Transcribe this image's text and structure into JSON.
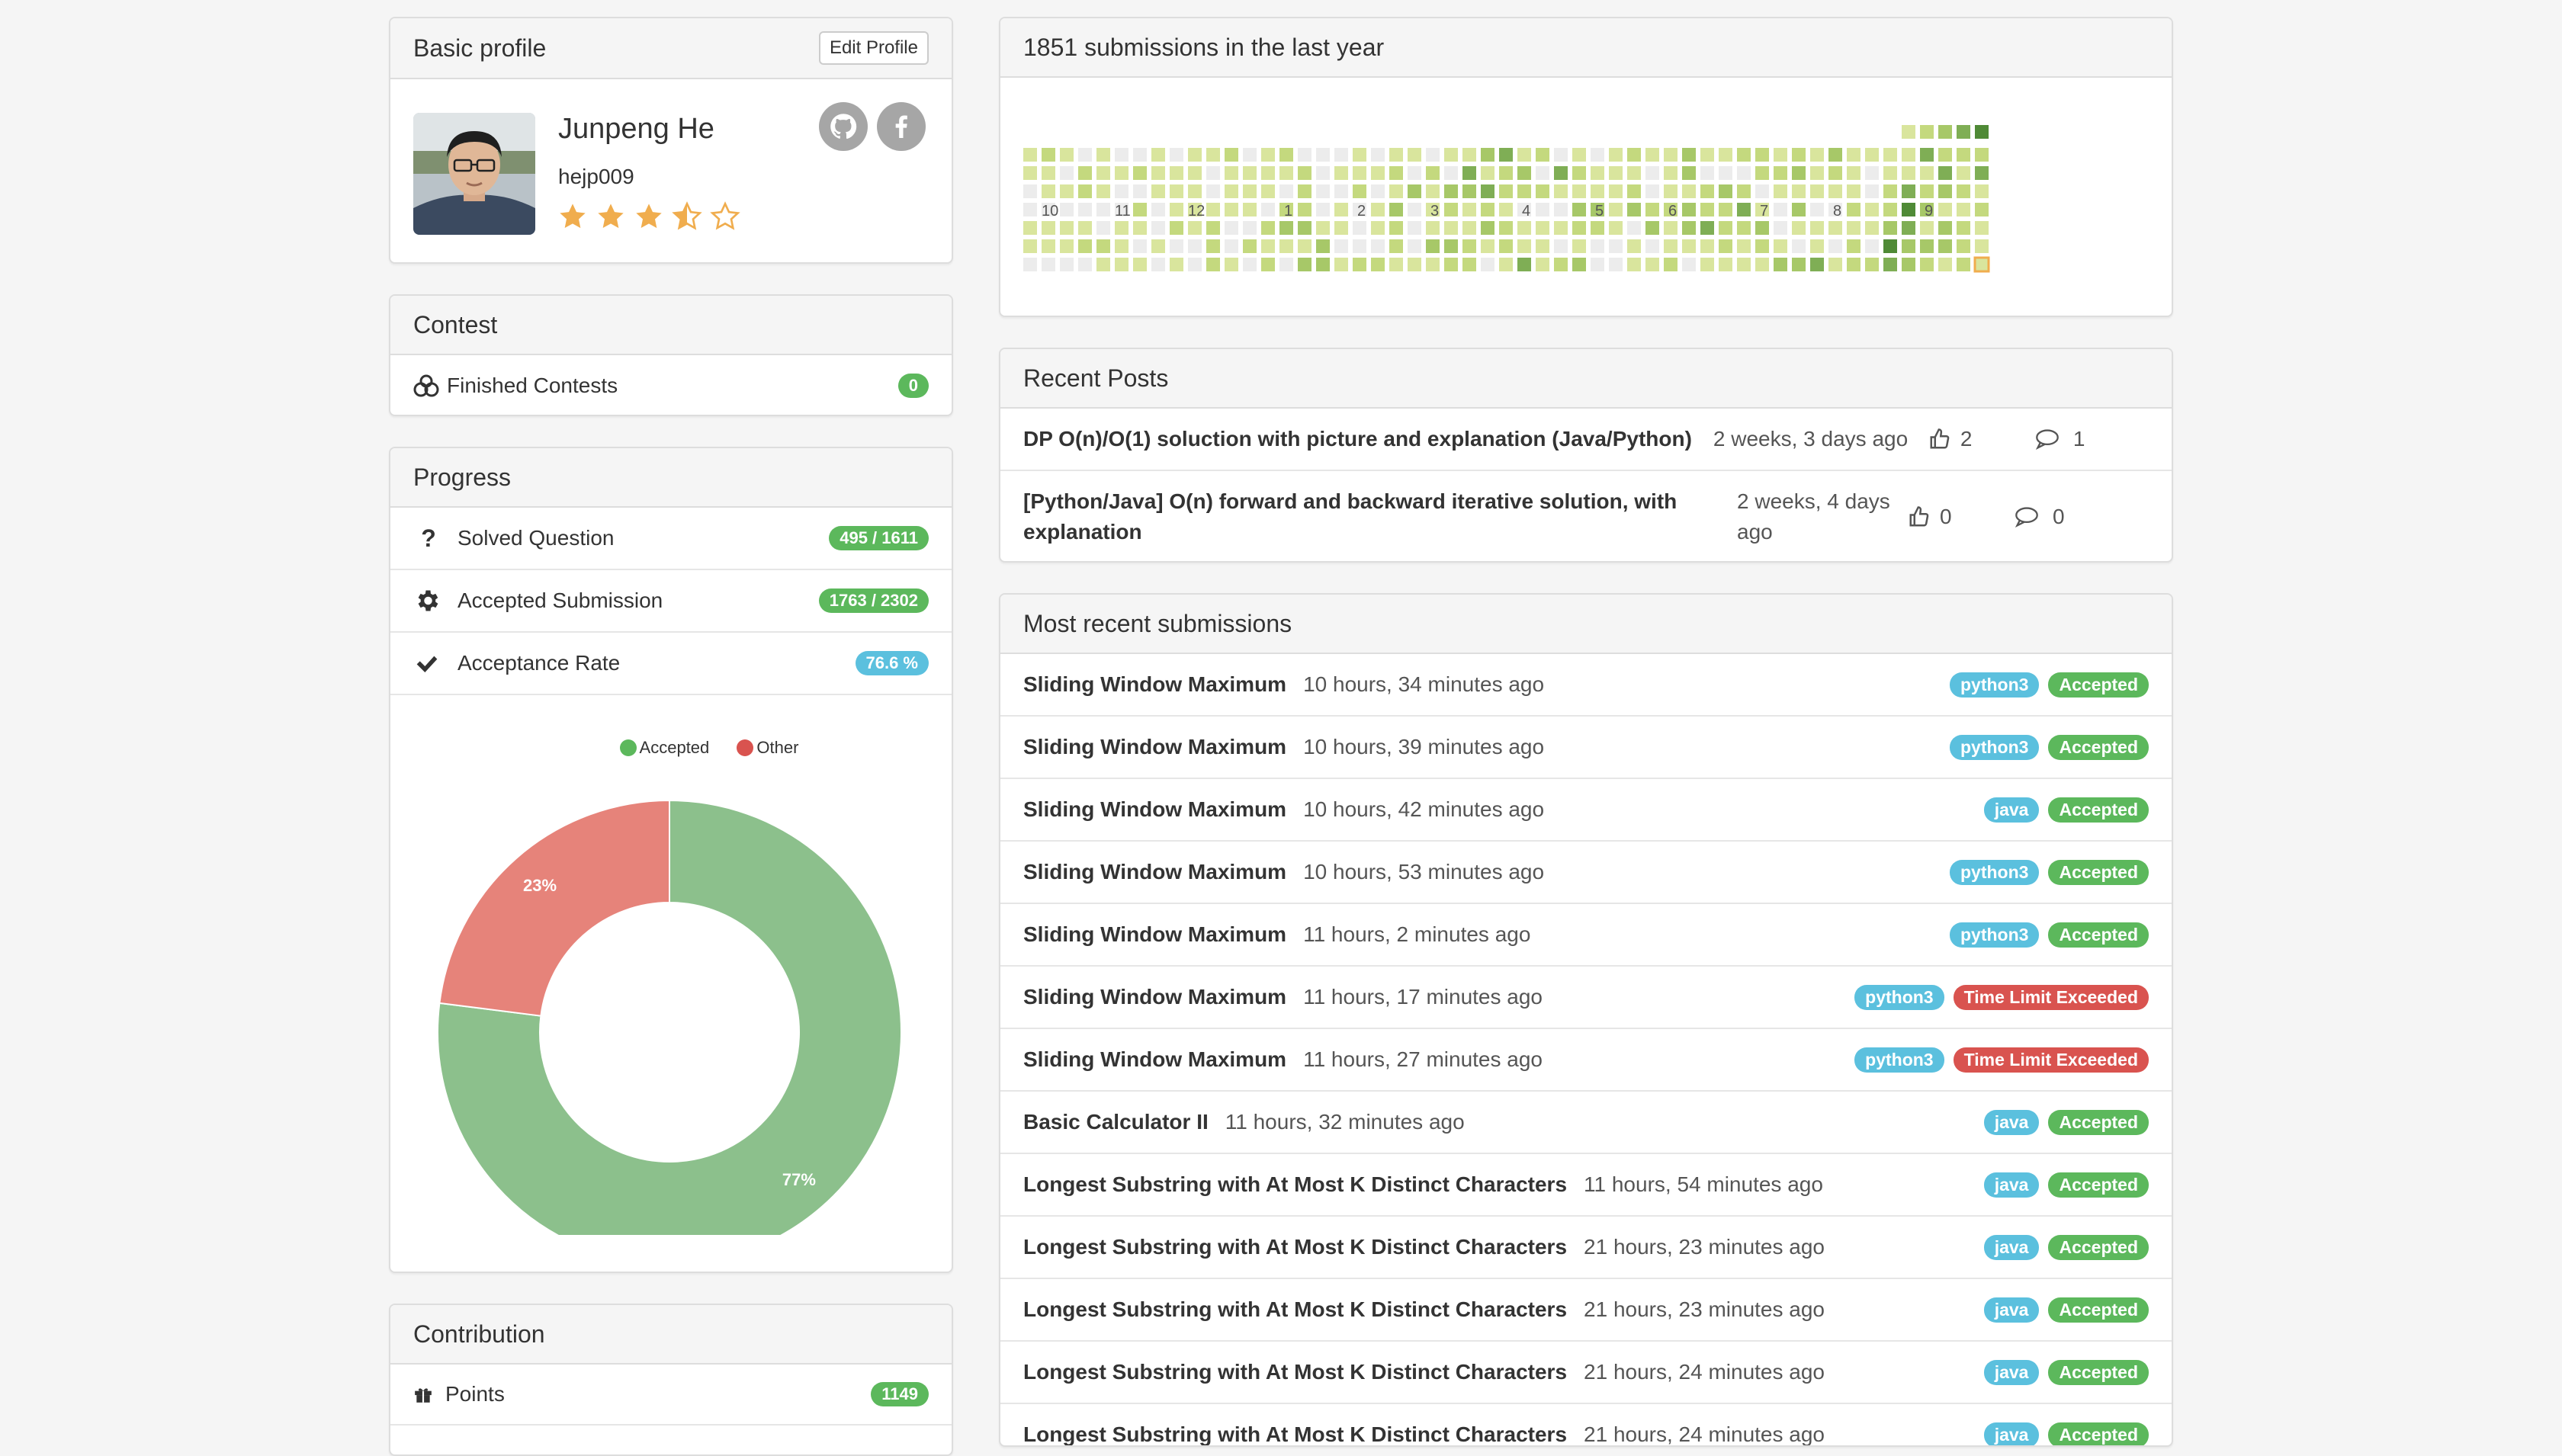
{
  "profile": {
    "header": "Basic profile",
    "edit_label": "Edit Profile",
    "name": "Junpeng He",
    "username": "hejp009",
    "rating": 3.5,
    "max_rating": 5
  },
  "contest": {
    "header": "Contest",
    "items": [
      {
        "label": "Finished Contests",
        "value": "0",
        "icon": "trophy-icon"
      }
    ]
  },
  "progress": {
    "header": "Progress",
    "items": [
      {
        "label": "Solved Question",
        "value": "495 / 1611",
        "icon": "question-icon"
      },
      {
        "label": "Accepted Submission",
        "value": "1763 / 2302",
        "icon": "gear-icon"
      },
      {
        "label": "Acceptance Rate",
        "value": "76.6 %",
        "icon": "check-icon"
      }
    ]
  },
  "chart_data": {
    "type": "pie",
    "donut": true,
    "labels": [
      "Accepted",
      "Other"
    ],
    "values": [
      77,
      23
    ],
    "value_labels": [
      "77%",
      "23%"
    ],
    "colors": [
      "#8cc08c",
      "#e6837a"
    ],
    "legend_colors": [
      "#5cb85c",
      "#d9534f"
    ],
    "legend_position": "top"
  },
  "contribution": {
    "header": "Contribution",
    "items": [
      {
        "label": "Points",
        "value": "1149",
        "icon": "gift-icon"
      }
    ]
  },
  "calendar": {
    "header": "1851 submissions in the last year",
    "months": [
      "10",
      "11",
      "12",
      "1",
      "2",
      "3",
      "4",
      "5",
      "6",
      "7",
      "8",
      "9"
    ]
  },
  "posts": {
    "header": "Recent Posts",
    "items": [
      {
        "title": "DP O(n)/O(1) soluction with picture and explanation (Java/Python)",
        "time": "2 weeks, 3 days ago",
        "votes": "2",
        "comments": "1"
      },
      {
        "title": "[Python/Java] O(n) forward and backward iterative solution, with explanation",
        "time": "2 weeks, 4 days ago",
        "votes": "0",
        "comments": "0"
      }
    ]
  },
  "submissions": {
    "header": "Most recent submissions",
    "items": [
      {
        "title": "Sliding Window Maximum",
        "time": "10 hours, 34 minutes ago",
        "lang": "python3",
        "status": "Accepted"
      },
      {
        "title": "Sliding Window Maximum",
        "time": "10 hours, 39 minutes ago",
        "lang": "python3",
        "status": "Accepted"
      },
      {
        "title": "Sliding Window Maximum",
        "time": "10 hours, 42 minutes ago",
        "lang": "java",
        "status": "Accepted"
      },
      {
        "title": "Sliding Window Maximum",
        "time": "10 hours, 53 minutes ago",
        "lang": "python3",
        "status": "Accepted"
      },
      {
        "title": "Sliding Window Maximum",
        "time": "11 hours, 2 minutes ago",
        "lang": "python3",
        "status": "Accepted"
      },
      {
        "title": "Sliding Window Maximum",
        "time": "11 hours, 17 minutes ago",
        "lang": "python3",
        "status": "Time Limit Exceeded"
      },
      {
        "title": "Sliding Window Maximum",
        "time": "11 hours, 27 minutes ago",
        "lang": "python3",
        "status": "Time Limit Exceeded"
      },
      {
        "title": "Basic Calculator II",
        "time": "11 hours, 32 minutes ago",
        "lang": "java",
        "status": "Accepted"
      },
      {
        "title": "Longest Substring with At Most K Distinct Characters",
        "time": "11 hours, 54 minutes ago",
        "lang": "java",
        "status": "Accepted"
      },
      {
        "title": "Longest Substring with At Most K Distinct Characters",
        "time": "21 hours, 23 minutes ago",
        "lang": "java",
        "status": "Accepted"
      },
      {
        "title": "Longest Substring with At Most K Distinct Characters",
        "time": "21 hours, 23 minutes ago",
        "lang": "java",
        "status": "Accepted"
      },
      {
        "title": "Longest Substring with At Most K Distinct Characters",
        "time": "21 hours, 24 minutes ago",
        "lang": "java",
        "status": "Accepted"
      },
      {
        "title": "Longest Substring with At Most K Distinct Characters",
        "time": "21 hours, 24 minutes ago",
        "lang": "java",
        "status": "Accepted"
      }
    ]
  }
}
